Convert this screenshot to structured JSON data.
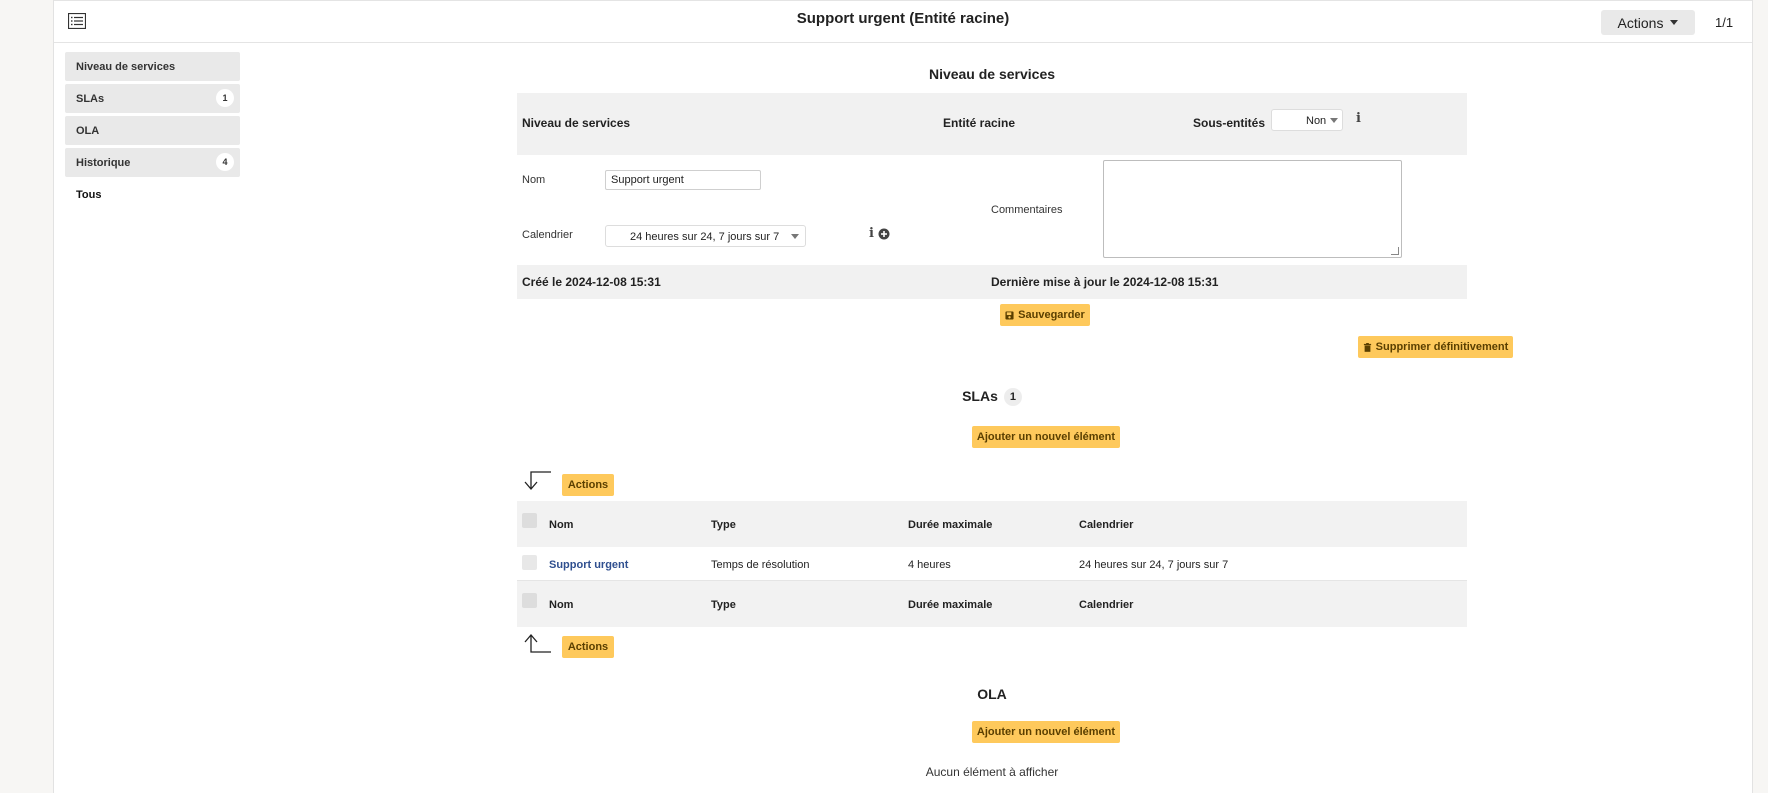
{
  "topbar": {
    "title": "Support urgent (Entité racine)",
    "actions_label": "Actions",
    "pager": "1/1"
  },
  "sidebar": {
    "items": [
      {
        "label": "Niveau de services",
        "badge": ""
      },
      {
        "label": "SLAs",
        "badge": "1"
      },
      {
        "label": "OLA",
        "badge": ""
      },
      {
        "label": "Historique",
        "badge": "4"
      },
      {
        "label": "Tous",
        "badge": ""
      }
    ]
  },
  "form": {
    "section_title": "Niveau de services",
    "header_left": "Niveau de services",
    "header_entity": "Entité racine",
    "subentities_label": "Sous-entités",
    "subentities_value": "Non",
    "name_label": "Nom",
    "name_value": "Support urgent",
    "calendar_label": "Calendrier",
    "calendar_value": "24 heures sur 24, 7 jours sur 7",
    "comments_label": "Commentaires",
    "comments_value": "",
    "created": "Créé le 2024-12-08 15:31",
    "updated": "Dernière mise à jour le 2024-12-08 15:31",
    "save_label": "Sauvegarder",
    "delete_label": "Supprimer définitivement"
  },
  "slas": {
    "title": "SLAs",
    "count": "1",
    "add_label": "Ajouter un nouvel élément",
    "actions_label": "Actions",
    "columns": [
      "Nom",
      "Type",
      "Durée maximale",
      "Calendrier"
    ],
    "rows": [
      {
        "name": "Support urgent",
        "type": "Temps de résolution",
        "duration": "4 heures",
        "calendar": "24 heures sur 24, 7 jours sur 7"
      }
    ]
  },
  "ola": {
    "title": "OLA",
    "add_label": "Ajouter un nouvel élément",
    "empty": "Aucun élément à afficher"
  },
  "colors": {
    "accent_button": "#fec95c",
    "link": "#2f4f8f",
    "panel_gray": "#f1f1f1"
  }
}
